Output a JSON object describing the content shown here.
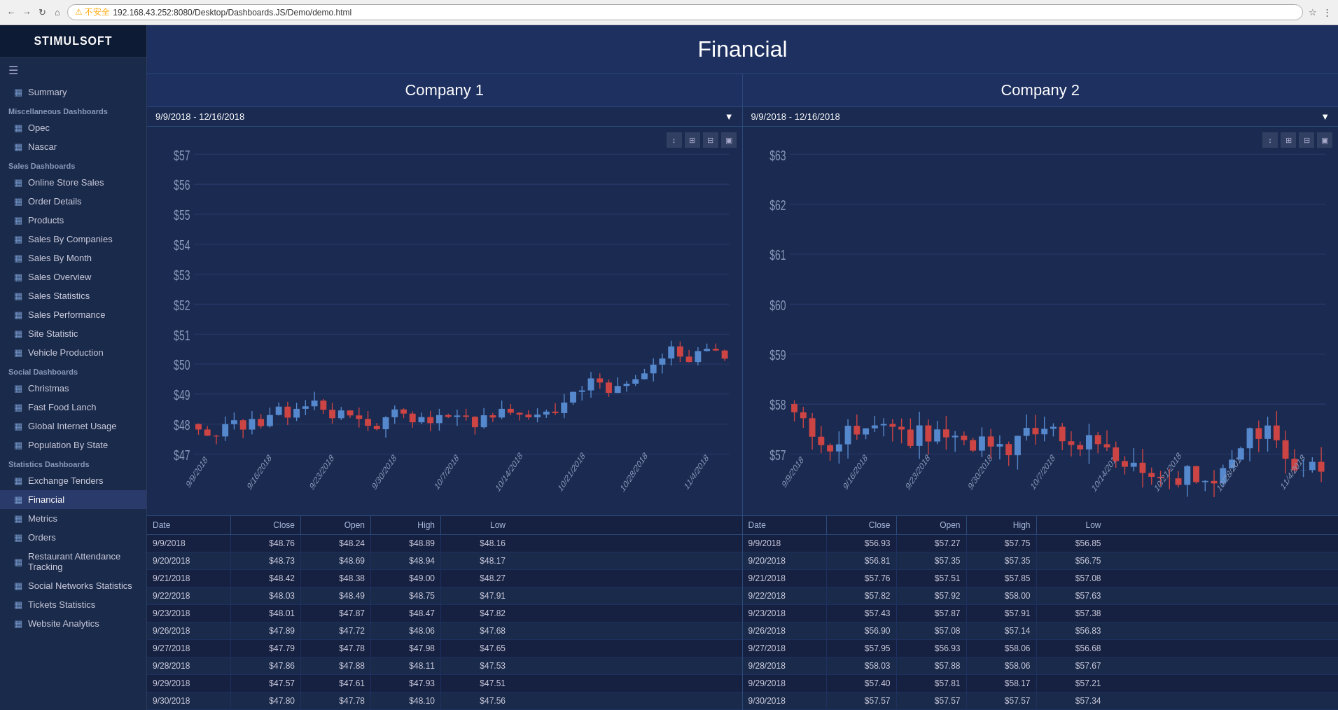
{
  "browser": {
    "url": "192.168.43.252:8080/Desktop/Dashboards.JS/Demo/demo.html",
    "warning": "不安全"
  },
  "sidebar": {
    "brand": "STIMULSOFT",
    "sections": [
      {
        "label": "Miscellaneous Dashboards",
        "items": [
          {
            "label": "Opec",
            "icon": "▦"
          },
          {
            "label": "Nascar",
            "icon": "▦"
          }
        ]
      },
      {
        "label": "Sales Dashboards",
        "items": [
          {
            "label": "Online Store Sales",
            "icon": "▦"
          },
          {
            "label": "Order Details",
            "icon": "▦"
          },
          {
            "label": "Products",
            "icon": "▦"
          },
          {
            "label": "Sales By Companies",
            "icon": "▦"
          },
          {
            "label": "Sales By Month",
            "icon": "▦"
          },
          {
            "label": "Sales Overview",
            "icon": "▦"
          },
          {
            "label": "Sales Statistics",
            "icon": "▦"
          },
          {
            "label": "Sales Performance",
            "icon": "▦"
          },
          {
            "label": "Site Statistic",
            "icon": "▦"
          },
          {
            "label": "Vehicle Production",
            "icon": "▦"
          }
        ]
      },
      {
        "label": "Social Dashboards",
        "items": [
          {
            "label": "Christmas",
            "icon": "▦"
          },
          {
            "label": "Fast Food Lanch",
            "icon": "▦"
          },
          {
            "label": "Global Internet Usage",
            "icon": "▦"
          },
          {
            "label": "Population By State",
            "icon": "▦"
          }
        ]
      },
      {
        "label": "Statistics Dashboards",
        "items": [
          {
            "label": "Exchange Tenders",
            "icon": "▦"
          },
          {
            "label": "Financial",
            "icon": "▦",
            "active": true
          },
          {
            "label": "Metrics",
            "icon": "▦"
          },
          {
            "label": "Orders",
            "icon": "▦"
          },
          {
            "label": "Restaurant Attendance Tracking",
            "icon": "▦"
          },
          {
            "label": "Social Networks Statistics",
            "icon": "▦"
          },
          {
            "label": "Tickets Statistics",
            "icon": "▦"
          },
          {
            "label": "Website Analytics",
            "icon": "▦"
          }
        ]
      }
    ]
  },
  "page": {
    "title": "Financial"
  },
  "companies": [
    {
      "title": "Company 1",
      "dateRange": "9/9/2018 - 12/16/2018",
      "yLabels": [
        "$57",
        "$56",
        "$55",
        "$54",
        "$53",
        "$52",
        "$51",
        "$50",
        "$49",
        "$48",
        "$47"
      ],
      "tableHeaders": [
        "Date",
        "Close",
        "Open",
        "High",
        "Low"
      ],
      "tableRows": [
        [
          "9/9/2018",
          "$48.76",
          "$48.24",
          "$48.89",
          "$48.16"
        ],
        [
          "9/20/2018",
          "$48.73",
          "$48.69",
          "$48.94",
          "$48.17"
        ],
        [
          "9/21/2018",
          "$48.42",
          "$48.38",
          "$49.00",
          "$48.27"
        ],
        [
          "9/22/2018",
          "$48.03",
          "$48.49",
          "$48.75",
          "$47.91"
        ],
        [
          "9/23/2018",
          "$48.01",
          "$47.87",
          "$48.47",
          "$47.82"
        ],
        [
          "9/26/2018",
          "$47.89",
          "$47.72",
          "$48.06",
          "$47.68"
        ],
        [
          "9/27/2018",
          "$47.79",
          "$47.78",
          "$47.98",
          "$47.65"
        ],
        [
          "9/28/2018",
          "$47.86",
          "$47.88",
          "$48.11",
          "$47.53"
        ],
        [
          "9/29/2018",
          "$47.57",
          "$47.61",
          "$47.93",
          "$47.51"
        ],
        [
          "9/30/2018",
          "$47.80",
          "$47.78",
          "$48.10",
          "$47.56"
        ]
      ]
    },
    {
      "title": "Company 2",
      "dateRange": "9/9/2018 - 12/16/2018",
      "yLabels": [
        "$63",
        "$62",
        "$61",
        "$60",
        "$59",
        "$58",
        "$57"
      ],
      "tableHeaders": [
        "Date",
        "Close",
        "Open",
        "High",
        "Low"
      ],
      "tableRows": [
        [
          "9/9/2018",
          "$56.93",
          "$57.27",
          "$57.75",
          "$56.85"
        ],
        [
          "9/20/2018",
          "$56.81",
          "$57.35",
          "$57.35",
          "$56.75"
        ],
        [
          "9/21/2018",
          "$57.76",
          "$57.51",
          "$57.85",
          "$57.08"
        ],
        [
          "9/22/2018",
          "$57.82",
          "$57.92",
          "$58.00",
          "$57.63"
        ],
        [
          "9/23/2018",
          "$57.43",
          "$57.87",
          "$57.91",
          "$57.38"
        ],
        [
          "9/26/2018",
          "$56.90",
          "$57.08",
          "$57.14",
          "$56.83"
        ],
        [
          "9/27/2018",
          "$57.95",
          "$56.93",
          "$58.06",
          "$56.68"
        ],
        [
          "9/28/2018",
          "$58.03",
          "$57.88",
          "$58.06",
          "$57.67"
        ],
        [
          "9/29/2018",
          "$57.40",
          "$57.81",
          "$58.17",
          "$57.21"
        ],
        [
          "9/30/2018",
          "$57.57",
          "$57.57",
          "$57.57",
          "$57.34"
        ]
      ]
    }
  ]
}
